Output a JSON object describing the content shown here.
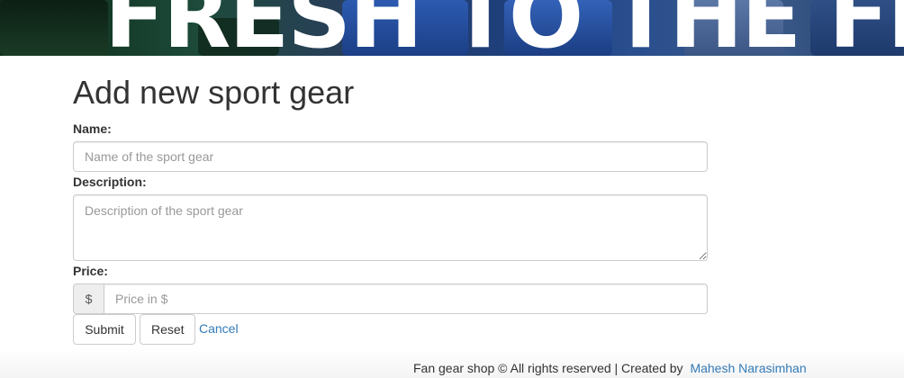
{
  "banner": {
    "headline": "FRESH TO THE FI"
  },
  "form": {
    "title": "Add new sport gear",
    "name_label": "Name:",
    "name_placeholder": "Name of the sport gear",
    "name_value": "",
    "description_label": "Description:",
    "description_placeholder": "Description of the sport gear",
    "description_value": "",
    "price_label": "Price:",
    "price_addon": "$",
    "price_placeholder": "Price in $",
    "price_value": "",
    "submit_label": "Submit",
    "reset_label": "Reset",
    "cancel_label": "Cancel"
  },
  "footer": {
    "text": "Fan gear shop © All rights reserved | Created by",
    "author": "Mahesh Narasimhan"
  },
  "colors": {
    "link": "#337ab7",
    "text": "#333333",
    "border": "#cccccc",
    "addon_bg": "#eeeeee"
  }
}
